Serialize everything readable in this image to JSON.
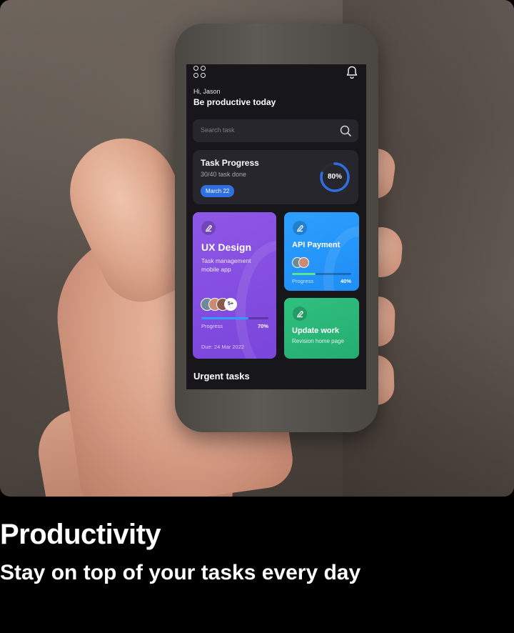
{
  "app": {
    "greeting": "Hi, Jason",
    "headline": "Be productive today",
    "search_placeholder": "Search task"
  },
  "task_progress": {
    "title": "Task Progress",
    "subtitle": "30/40 task done",
    "date_badge": "March 22",
    "percent_label": "80%",
    "percent_value": 0.8
  },
  "cards": {
    "ux": {
      "title": "UX Design",
      "subtitle": "Task management mobile app",
      "avatars_more": "5+",
      "progress_label": "Progress",
      "progress_value_label": "70%",
      "progress_value": 0.7,
      "due": "Due: 24 Mar 2022",
      "color": "#7a45db"
    },
    "api": {
      "title": "API Payment",
      "progress_label": "Progress",
      "progress_value_label": "40%",
      "progress_value": 0.4,
      "color": "#1e8df5"
    },
    "update": {
      "title": "Update work",
      "subtitle": "Revision home page",
      "color": "#25ad6f"
    }
  },
  "section": {
    "urgent_title": "Urgent tasks"
  },
  "caption": {
    "title": "Productivity",
    "subtitle": "Stay on top of your tasks every day"
  },
  "colors": {
    "screen_bg": "#17171b",
    "card_bg": "#26262c",
    "accent_blue": "#2f6fe0",
    "ring_track": "#2b2b33"
  }
}
